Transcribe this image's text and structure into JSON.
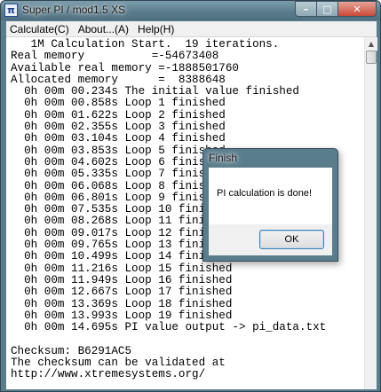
{
  "window": {
    "title_prefix": "Super PI / ",
    "title_rest": "mod1.5 XS",
    "icon_glyph": "π",
    "minimize_glyph": "–",
    "maximize_glyph": "□",
    "close_glyph": "✕"
  },
  "menu": [
    {
      "label": "Calculate(C)"
    },
    {
      "label": "About...(A)"
    },
    {
      "label": "Help(H)"
    }
  ],
  "output_lines": [
    "   1M Calculation Start.  19 iterations.",
    "Real memory          =-54673408",
    "Available real memory =-1888501760",
    "Allocated memory      =  8388648",
    "  0h 00m 00.234s The initial value finished",
    "  0h 00m 00.858s Loop 1 finished",
    "  0h 00m 01.622s Loop 2 finished",
    "  0h 00m 02.355s Loop 3 finished",
    "  0h 00m 03.104s Loop 4 finished",
    "  0h 00m 03.853s Loop 5 finished",
    "  0h 00m 04.602s Loop 6 finished",
    "  0h 00m 05.335s Loop 7 finished",
    "  0h 00m 06.068s Loop 8 finished",
    "  0h 00m 06.801s Loop 9 finished",
    "  0h 00m 07.535s Loop 10 finished",
    "  0h 00m 08.268s Loop 11 finished",
    "  0h 00m 09.017s Loop 12 finished",
    "  0h 00m 09.765s Loop 13 finished",
    "  0h 00m 10.499s Loop 14 finished",
    "  0h 00m 11.216s Loop 15 finished",
    "  0h 00m 11.949s Loop 16 finished",
    "  0h 00m 12.667s Loop 17 finished",
    "  0h 00m 13.369s Loop 18 finished",
    "  0h 00m 13.993s Loop 19 finished",
    "  0h 00m 14.695s PI value output -> pi_data.txt",
    "",
    "Checksum: B6291AC5",
    "The checksum can be validated at",
    "http://www.xtremesystems.org/"
  ],
  "scrollbar": {
    "up_glyph": "▲"
  },
  "dialog": {
    "title": "Finish",
    "message": "PI calculation is done!",
    "ok_label": "OK"
  }
}
